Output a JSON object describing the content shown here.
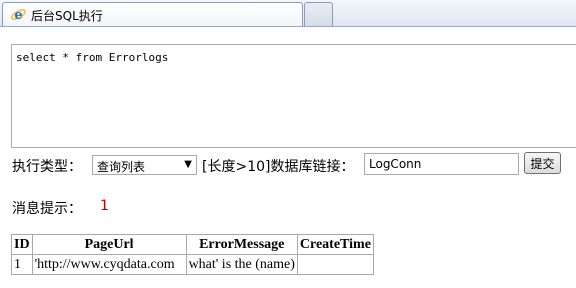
{
  "window": {
    "tab_title": "后台SQL执行",
    "tab_icon": "ie-browser-icon"
  },
  "sql": {
    "query": "select * from Errorlogs"
  },
  "controls": {
    "exec_type_label": "执行类型：",
    "exec_type_selected": "查询列表",
    "length_conn_label": "[长度>10]数据库链接：",
    "conn_value": "LogConn",
    "submit_label": "提交"
  },
  "message": {
    "label": "消息提示：",
    "value": "1",
    "value_color": "#cc0000"
  },
  "results": {
    "columns": [
      "ID",
      "PageUrl",
      "ErrorMessage",
      "CreateTime"
    ],
    "rows": [
      [
        "1",
        "'http://www.cyqdata.com",
        "what' is the (name)",
        ""
      ]
    ]
  }
}
